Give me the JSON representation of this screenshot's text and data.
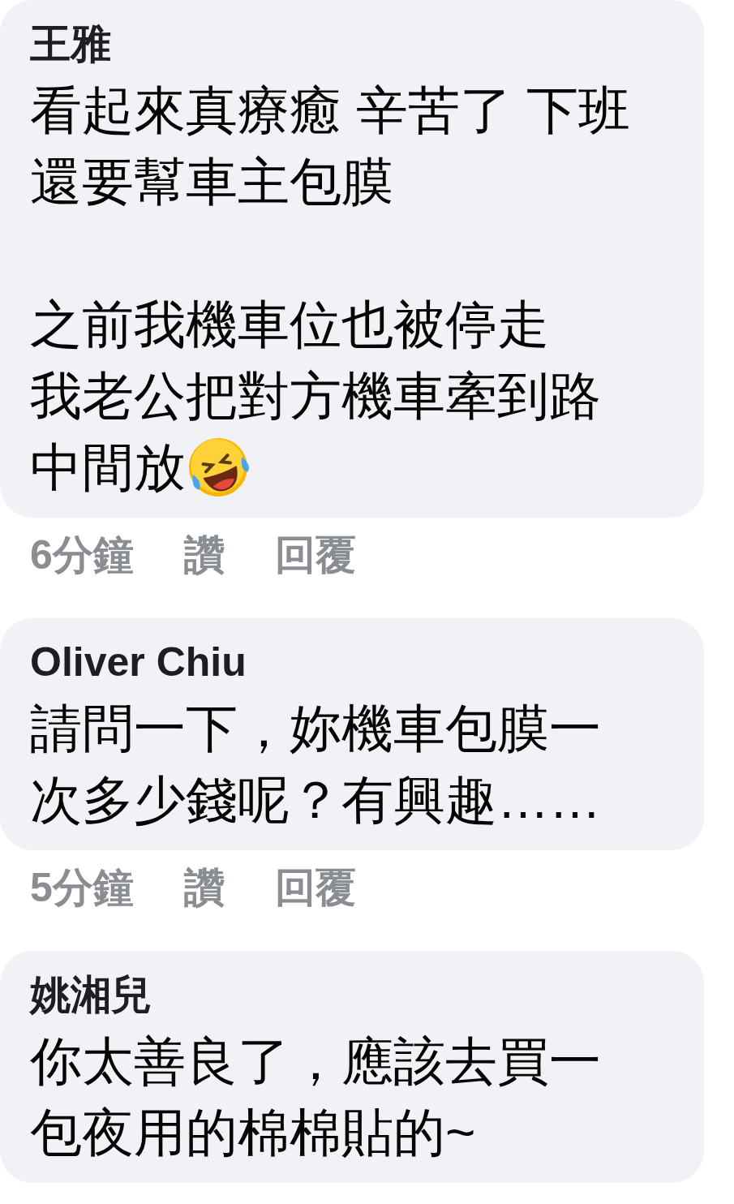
{
  "comments": [
    {
      "author": "王雅",
      "paragraphs": [
        [
          "看起來真療癒 辛苦了 下班",
          "還要幫車主包膜"
        ],
        [
          "之前我機車位也被停走",
          "我老公把對方機車牽到路",
          "中間放"
        ]
      ],
      "emoji": true,
      "time": "6分鐘",
      "actions": [
        "讚",
        "回覆"
      ]
    },
    {
      "author": "Oliver Chiu",
      "paragraphs": [
        [
          "請問一下，妳機車包膜一",
          "次多少錢呢？有興趣……"
        ]
      ],
      "time": "5分鐘",
      "actions": [
        "讚",
        "回覆"
      ]
    },
    {
      "author": "姚湘兒",
      "paragraphs": [
        [
          "你太善良了，應該去買一",
          "包夜用的棉棉貼的~"
        ]
      ]
    }
  ]
}
